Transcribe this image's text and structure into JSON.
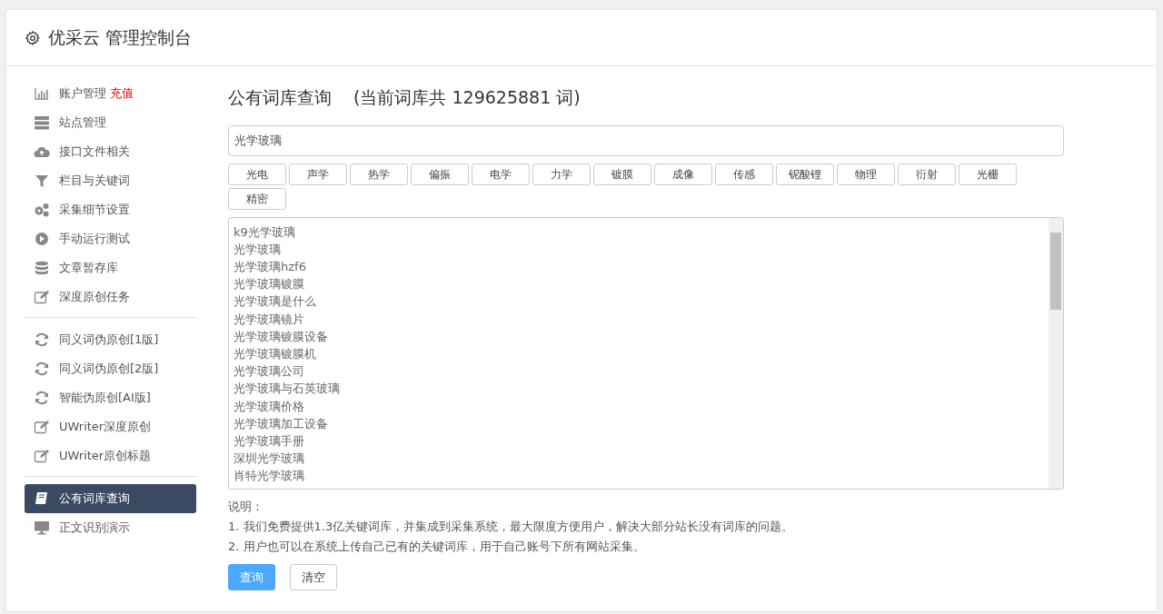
{
  "header": {
    "title": "优采云 管理控制台"
  },
  "sidebar": {
    "groups": [
      [
        {
          "label": "账户管理",
          "extra": "充值",
          "selected": false
        },
        {
          "label": "站点管理",
          "selected": false
        },
        {
          "label": "接口文件相关",
          "selected": false
        },
        {
          "label": "栏目与关键词",
          "selected": false
        },
        {
          "label": "采集细节设置",
          "selected": false
        },
        {
          "label": "手动运行测试",
          "selected": false
        },
        {
          "label": "文章暂存库",
          "selected": false
        },
        {
          "label": "深度原创任务",
          "selected": false
        }
      ],
      [
        {
          "label": "同义词伪原创[1版]",
          "selected": false
        },
        {
          "label": "同义词伪原创[2版]",
          "selected": false
        },
        {
          "label": "智能伪原创[AI版]",
          "selected": false
        },
        {
          "label": "UWriter深度原创",
          "selected": false
        },
        {
          "label": "UWriter原创标题",
          "selected": false
        }
      ],
      [
        {
          "label": "公有词库查询",
          "selected": true
        },
        {
          "label": "正文识别演示",
          "selected": false
        }
      ]
    ]
  },
  "main": {
    "title": "公有词库查询",
    "count_note": "(当前词库共 129625881 词)",
    "search": {
      "value": "光学玻璃"
    },
    "tags": [
      "光电",
      "声学",
      "热学",
      "偏振",
      "电学",
      "力学",
      "镀膜",
      "成像",
      "传感",
      "铌酸锂",
      "物理",
      "衍射",
      "光栅",
      "精密"
    ],
    "results": [
      "k9光学玻璃",
      "光学玻璃",
      "光学玻璃hzf6",
      "光学玻璃镀膜",
      "光学玻璃是什么",
      "光学玻璃镜片",
      "光学玻璃镀膜设备",
      "光学玻璃镀膜机",
      "光学玻璃公司",
      "光学玻璃与石英玻璃",
      "光学玻璃价格",
      "光学玻璃加工设备",
      "光学玻璃手册",
      "深圳光学玻璃",
      "肖特光学玻璃"
    ],
    "notes_title": "说明：",
    "notes": [
      "1. 我们免费提供1.3亿关键词库，并集成到采集系统，最大限度方便用户，解决大部分站长没有词库的问题。",
      "2. 用户也可以在系统上传自己已有的关键词库，用于自己账号下所有网站采集。"
    ],
    "buttons": [
      {
        "label": "查询",
        "kind": "primary"
      },
      {
        "label": "清空",
        "kind": "default"
      }
    ]
  }
}
